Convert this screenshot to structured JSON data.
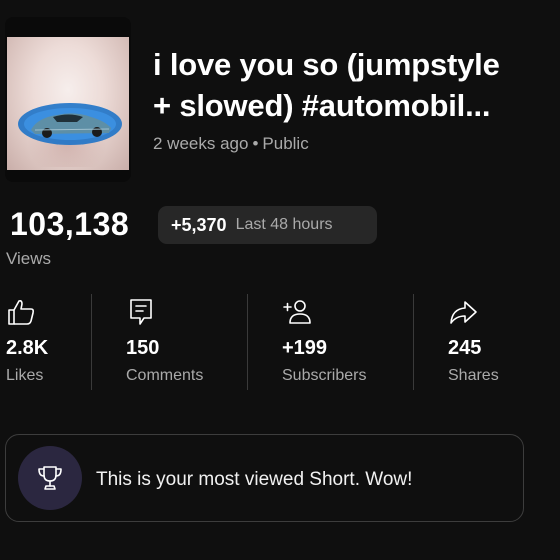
{
  "video": {
    "title_line1": "i love you so (jumpstyle",
    "title_line2": "+ slowed) #automobil...",
    "age": "2 weeks ago",
    "separator": "•",
    "visibility": "Public"
  },
  "views": {
    "count": "103,138",
    "label": "Views",
    "delta": "+5,370",
    "period": "Last 48 hours"
  },
  "stats": [
    {
      "icon": "thumbs-up-icon",
      "value": "2.8K",
      "label": "Likes"
    },
    {
      "icon": "comment-icon",
      "value": "150",
      "label": "Comments"
    },
    {
      "icon": "add-person-icon",
      "value": "+199",
      "label": "Subscribers"
    },
    {
      "icon": "share-icon",
      "value": "245",
      "label": "Shares"
    }
  ],
  "banner": {
    "icon": "trophy-icon",
    "message": "This is your most viewed Short. Wow!"
  },
  "colors": {
    "background": "#0f0f0f",
    "secondary_text": "#aaaaaa",
    "pill": "#272727",
    "trophy_bg": "#2b2740"
  }
}
